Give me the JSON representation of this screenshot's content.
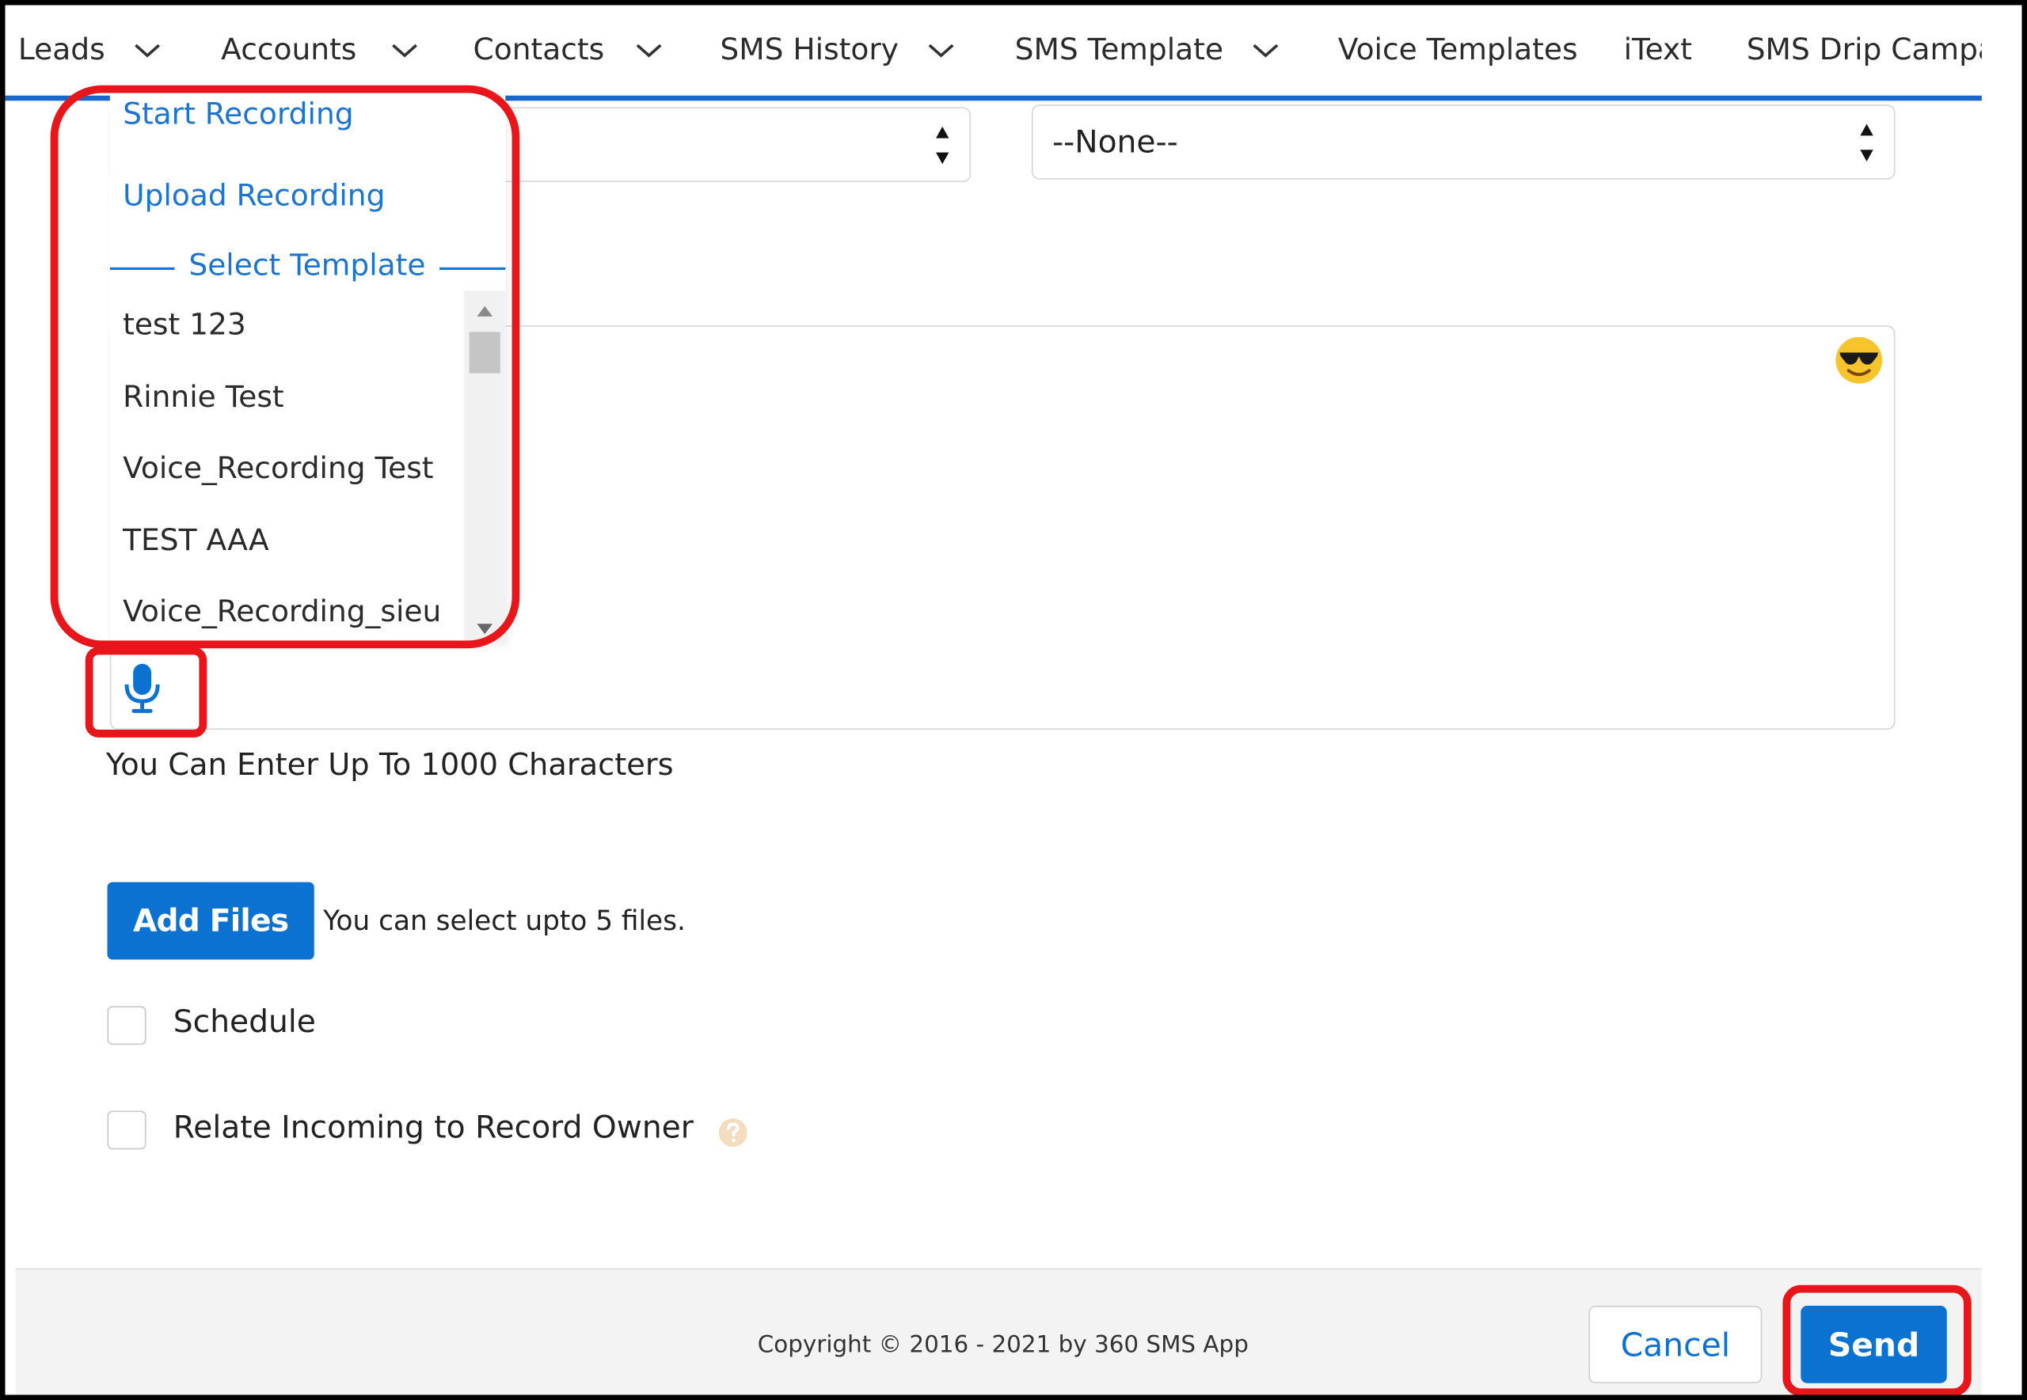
{
  "nav": {
    "items": [
      {
        "label": "Leads",
        "has_menu": true
      },
      {
        "label": "Accounts",
        "has_menu": true
      },
      {
        "label": "Contacts",
        "has_menu": true
      },
      {
        "label": "SMS History",
        "has_menu": true
      },
      {
        "label": "SMS Template",
        "has_menu": true
      },
      {
        "label": "Voice Templates",
        "has_menu": false
      },
      {
        "label": "iText",
        "has_menu": false
      },
      {
        "label": "SMS Drip Campa",
        "has_menu": false
      }
    ],
    "accent_color": "#1b66c9"
  },
  "form": {
    "second_select_value": "--None--",
    "char_limit_hint": "You Can Enter Up To 1000 Characters",
    "add_files_label": "Add Files",
    "files_note": "You can select upto 5 files.",
    "schedule_label": "Schedule",
    "relate_label": "Relate Incoming to Record Owner"
  },
  "dropdown": {
    "start_recording": "Start Recording",
    "upload_recording": "Upload Recording",
    "select_template_label": "Select Template",
    "templates": [
      "test 123",
      "Rinnie Test",
      "Voice_Recording Test",
      "TEST AAA",
      "Voice_Recording_sieu"
    ]
  },
  "footer": {
    "copyright": "Copyright © 2016 - 2021 by 360 SMS App",
    "cancel_label": "Cancel",
    "send_label": "Send"
  },
  "icons": {
    "emoji": "sunglasses-emoji-icon",
    "mic": "microphone-icon",
    "help": "help-icon",
    "chevron": "chevron-down-icon"
  },
  "colors": {
    "primary": "#0b72d1",
    "highlight": "#e8161b"
  }
}
